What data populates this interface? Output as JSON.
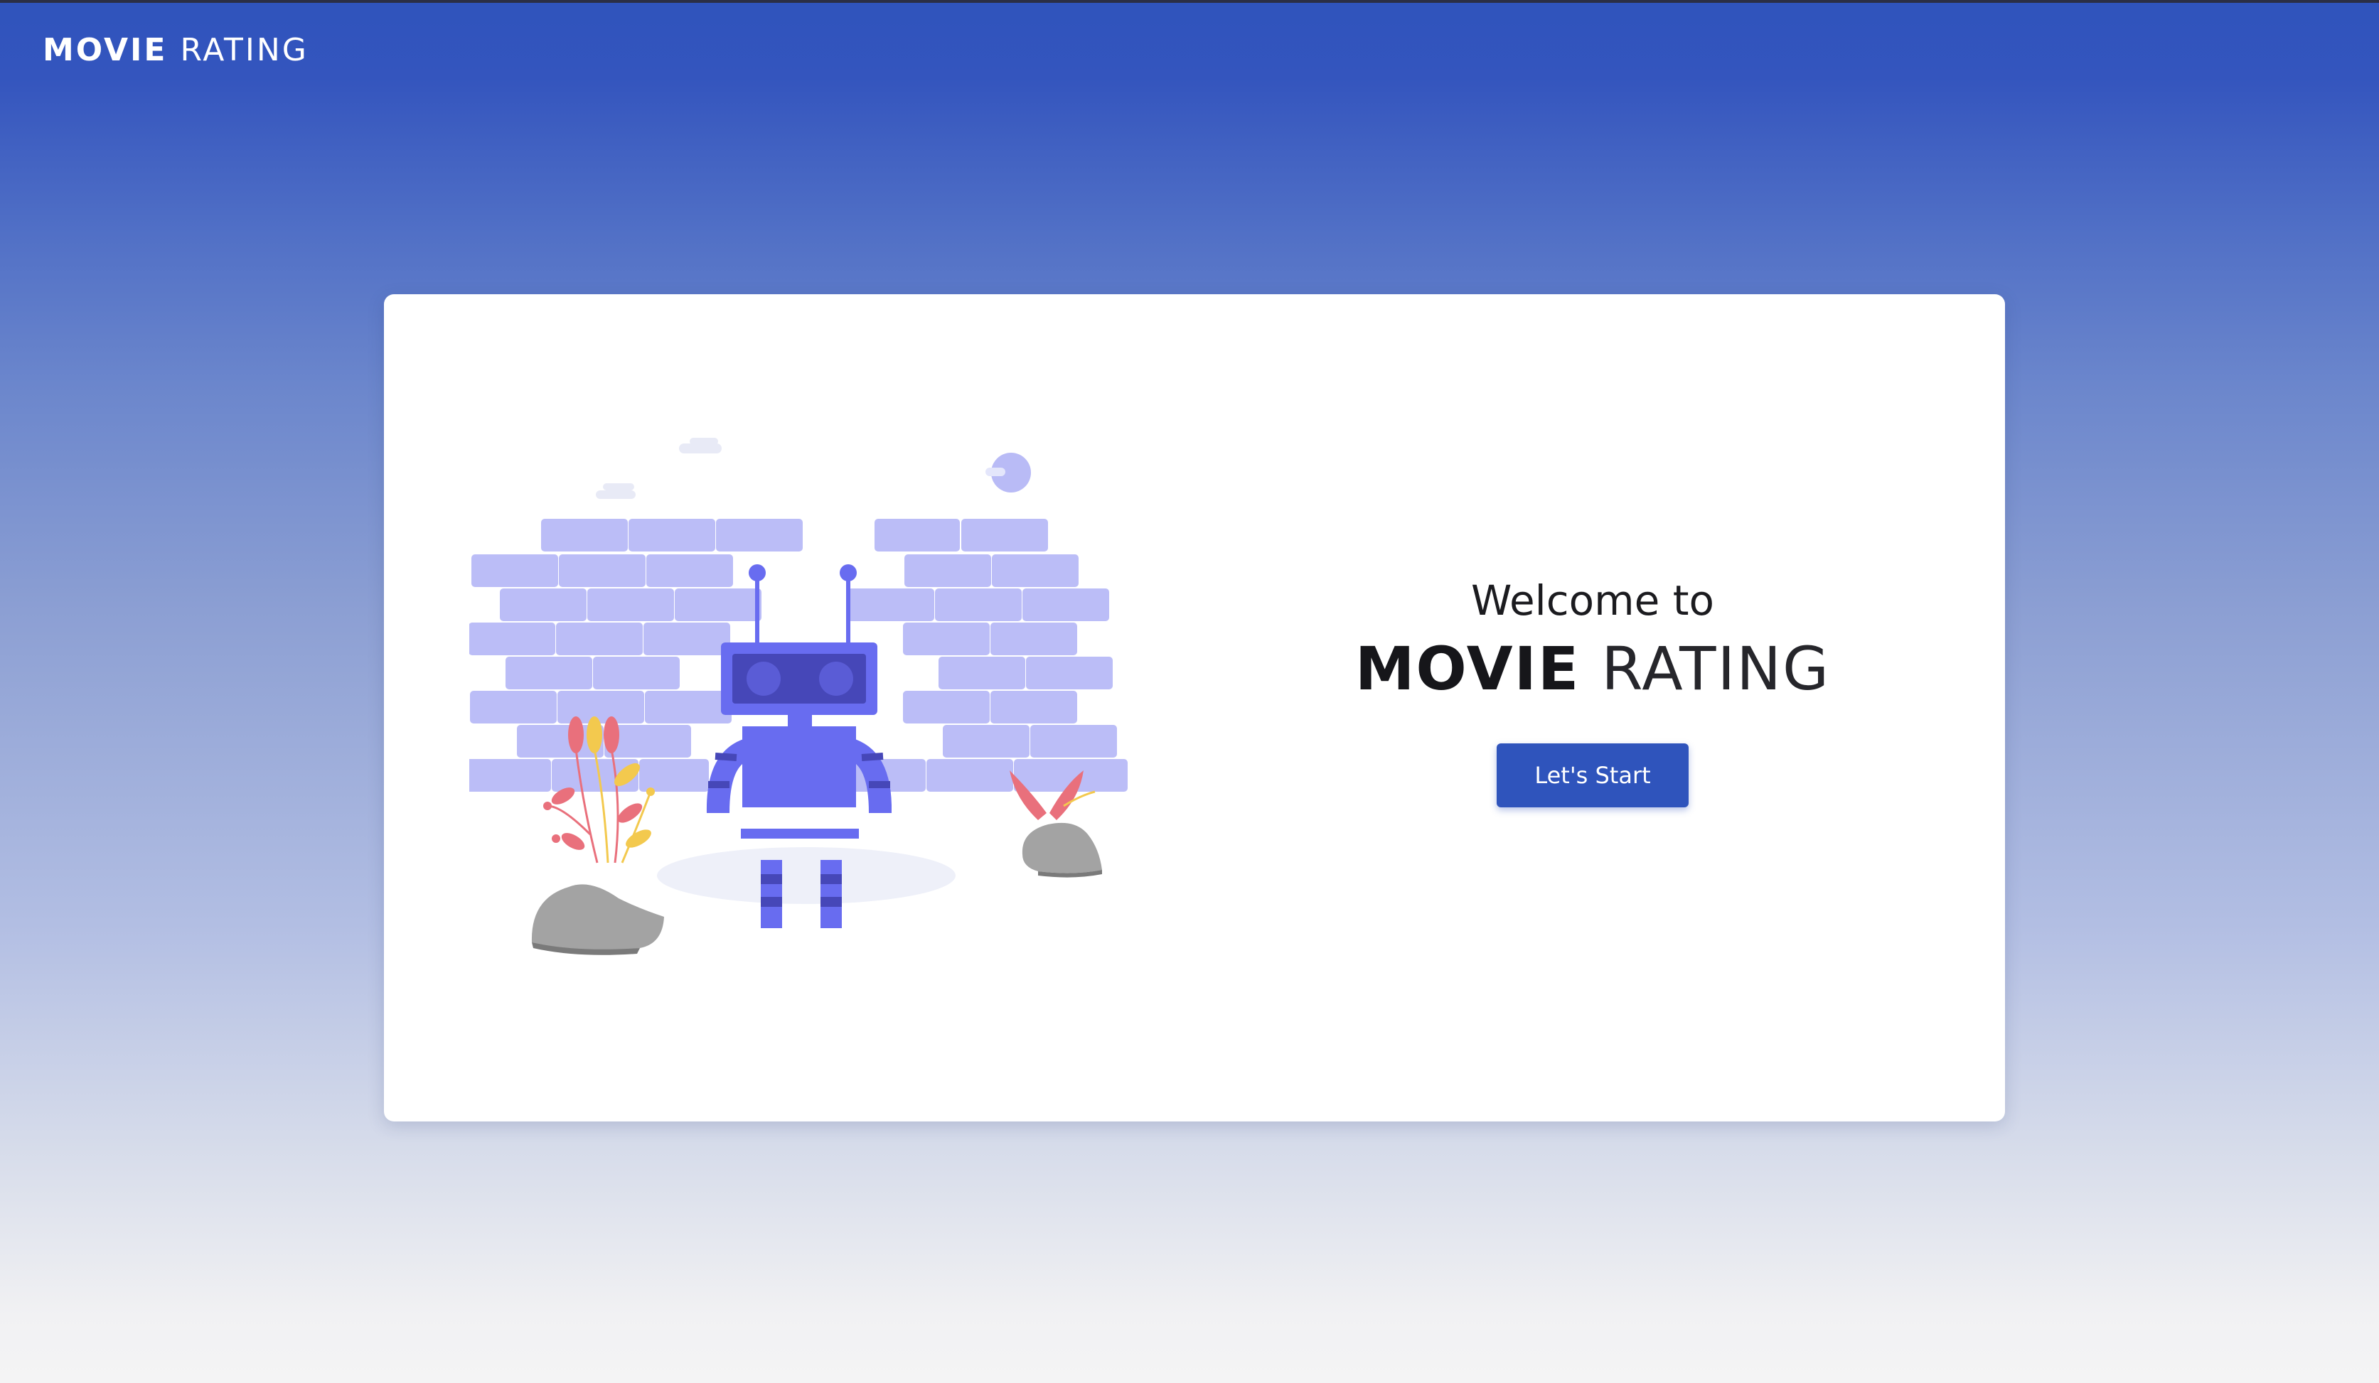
{
  "header": {
    "brand_strong": "MOVIE",
    "brand_light": "RATING"
  },
  "welcome": {
    "greeting": "Welcome to",
    "title_strong": "MOVIE",
    "title_light": "RATING",
    "start_button_label": "Let's Start"
  },
  "illustration": {
    "subject": "robot-illustration"
  },
  "colors": {
    "header_blue": "#2f54bc",
    "card_background": "#ffffff",
    "brick": "#bbbdf7",
    "robot": "#686cf0",
    "robot_dark": "#4647b8",
    "rock": "#a3a3a3",
    "flower_pink": "#e9707c",
    "flower_yellow": "#f3c94e"
  }
}
